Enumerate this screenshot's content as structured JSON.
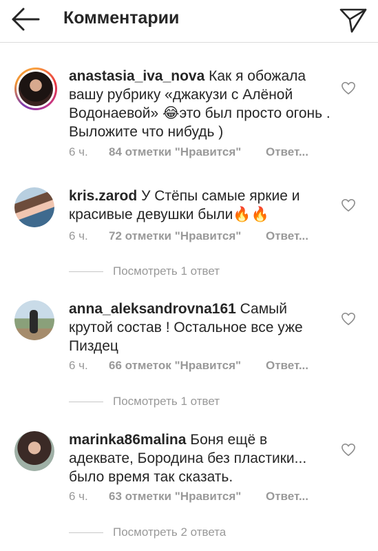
{
  "header": {
    "title": "Комментарии",
    "back_icon": "arrow-left-icon",
    "send_icon": "paper-plane-icon"
  },
  "colors": {
    "text": "#262626",
    "meta": "#999999",
    "divider": "#dbdbdb",
    "story_ring": "#e8373f"
  },
  "comments": [
    {
      "username": "anastasia_iva_nova",
      "text": "Как я обожала вашу рубрику «джакузи  с Алёной Водонаевой» 😂это был просто огонь . Выложите что нибудь )",
      "time": "6 ч.",
      "likes": "84 отметки \"Нравится\"",
      "reply": "Ответ..."
    },
    {
      "username": "kris.zarod",
      "text": "У Стёпы самые яркие и красивые девушки были🔥🔥",
      "time": "6 ч.",
      "likes": "72 отметки \"Нравится\"",
      "reply": "Ответ...",
      "view_replies": "Посмотреть 1 ответ"
    },
    {
      "username": "anna_aleksandrovna161",
      "text": "Самый крутой состав ! Остальное все уже Пиздец",
      "time": "6 ч.",
      "likes": "66 отметок \"Нравится\"",
      "reply": "Ответ...",
      "view_replies": "Посмотреть 1 ответ"
    },
    {
      "username": "marinka86malina",
      "text": "Боня ещё в адеквате, Бородина без пластики... было время так сказать.",
      "time": "6 ч.",
      "likes": "63 отметки \"Нравится\"",
      "reply": "Ответ...",
      "view_replies": "Посмотреть 2 ответа"
    }
  ]
}
